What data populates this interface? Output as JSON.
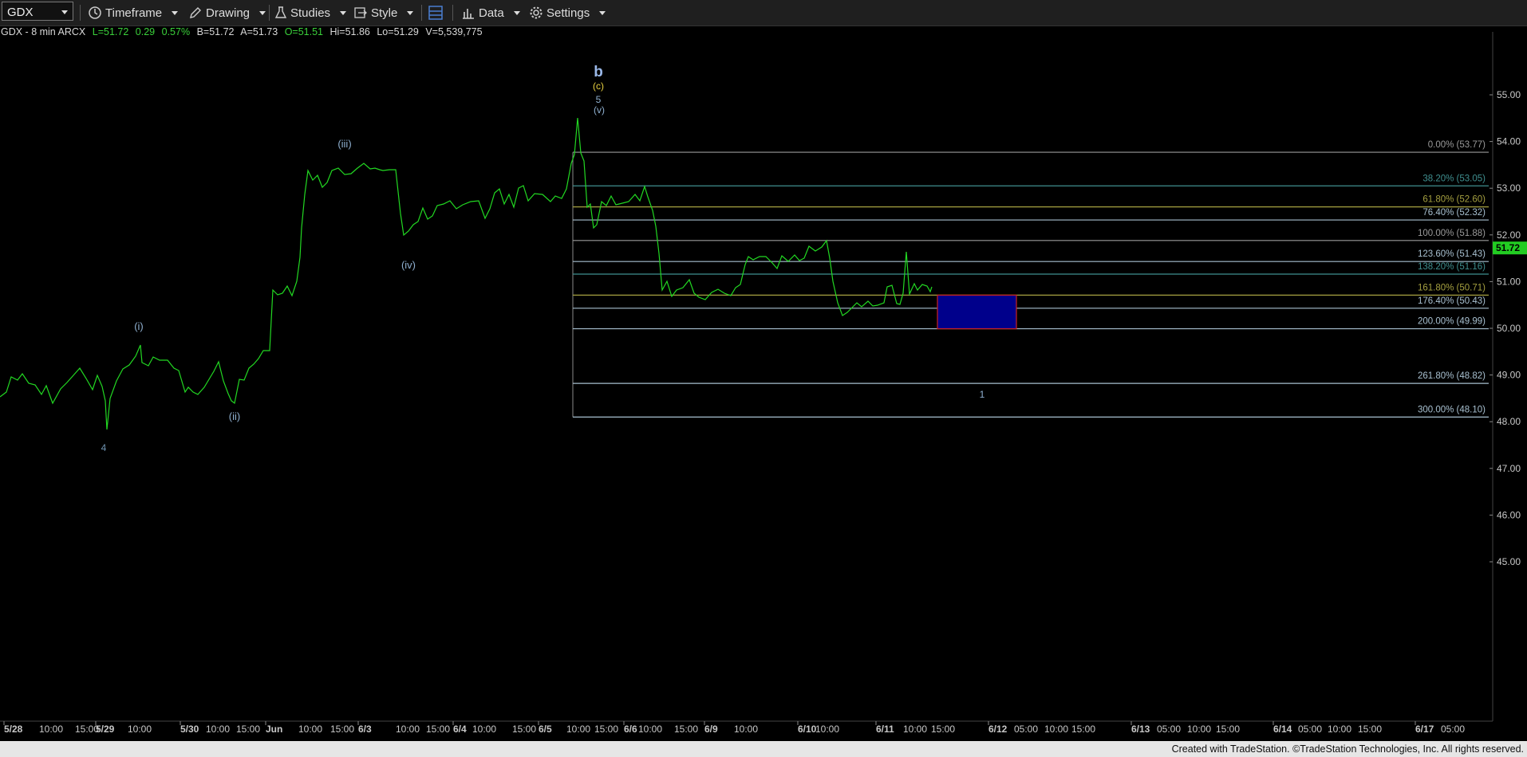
{
  "toolbar": {
    "symbol": "GDX",
    "timeframe_label": "Timeframe",
    "drawing_label": "Drawing",
    "studies_label": "Studies",
    "style_label": "Style",
    "data_label": "Data",
    "settings_label": "Settings"
  },
  "quote": {
    "title": "GDX - 8 min ARCX",
    "last": "L=51.72",
    "change": "0.29",
    "change_pct": "0.57%",
    "bid": "B=51.72",
    "ask": "A=51.73",
    "open": "O=51.51",
    "high": "Hi=51.86",
    "low": "Lo=51.29",
    "volume": "V=5,539,775"
  },
  "price_axis": {
    "ticks": [
      "55.00",
      "54.00",
      "53.00",
      "52.00",
      "51.00",
      "50.00",
      "49.00",
      "48.00",
      "47.00",
      "46.00",
      "45.00"
    ],
    "current_price": "51.72",
    "current_color": "#22cc22"
  },
  "time_axis": {
    "labels": [
      "5/28",
      "10:00",
      "15:00",
      "5/29",
      "10:00",
      "5/30",
      "10:00",
      "15:00",
      "Jun",
      "10:00",
      "15:00",
      "6/3",
      "10:00",
      "15:00",
      "6/4",
      "10:00",
      "15:00",
      "6/5",
      "10:00",
      "15:00",
      "6/6",
      "10:00",
      "15:00",
      "6/9",
      "10:00",
      "6/10",
      "10:00",
      "6/11",
      "10:00",
      "15:00",
      "6/12",
      "05:00",
      "10:00",
      "15:00",
      "6/13",
      "05:00",
      "10:00",
      "15:00",
      "6/14",
      "05:00",
      "10:00",
      "15:00",
      "6/17",
      "05:00"
    ]
  },
  "fib_levels": [
    {
      "label": "0.00% (53.77)",
      "price": 53.77,
      "color": "#9a9a9a"
    },
    {
      "label": "38.20% (53.05)",
      "price": 53.05,
      "color": "#3f8f8f"
    },
    {
      "label": "61.80% (52.60)",
      "price": 52.6,
      "color": "#a5a040"
    },
    {
      "label": "76.40% (52.32)",
      "price": 52.32,
      "color": "#a8c0d0"
    },
    {
      "label": "100.00% (51.88)",
      "price": 51.88,
      "color": "#9a9a9a"
    },
    {
      "label": "123.60% (51.43)",
      "price": 51.43,
      "color": "#a8c0d0"
    },
    {
      "label": "138.20% (51.16)",
      "price": 51.16,
      "color": "#3f8f8f"
    },
    {
      "label": "161.80% (50.71)",
      "price": 50.71,
      "color": "#a5a040"
    },
    {
      "label": "176.40% (50.43)",
      "price": 50.43,
      "color": "#a8c0d0"
    },
    {
      "label": "200.00% (49.99)",
      "price": 49.99,
      "color": "#a8c0d0"
    },
    {
      "label": "261.80% (48.82)",
      "price": 48.82,
      "color": "#a8c0d0"
    },
    {
      "label": "300.00% (48.10)",
      "price": 48.1,
      "color": "#a8c0d0"
    }
  ],
  "wave_labels": [
    {
      "text": "4",
      "color": "#6f93b0"
    },
    {
      "text": "(i)",
      "color": "#8fb0d0"
    },
    {
      "text": "(ii)",
      "color": "#8fb0d0"
    },
    {
      "text": "(iii)",
      "color": "#8fb0d0"
    },
    {
      "text": "(iv)",
      "color": "#8fb0d0"
    },
    {
      "text": "b",
      "color": "#9ab8e8"
    },
    {
      "text": "(c)",
      "color": "#e8d040"
    },
    {
      "text": "5",
      "color": "#8fb0d0"
    },
    {
      "text": "(v)",
      "color": "#8fb0d0"
    },
    {
      "text": "1",
      "color": "#8fb0d0"
    }
  ],
  "target_box": {
    "top_price": 50.71,
    "bottom_price": 49.99,
    "fill": "#00008b",
    "border": "#cc2222"
  },
  "colors": {
    "price_line": "#22d822",
    "background": "#000000",
    "toolbar": "#1f1f1f"
  },
  "footer": {
    "watermark": "Created with TradeStation. ©TradeStation Technologies, Inc. All rights reserved."
  }
}
